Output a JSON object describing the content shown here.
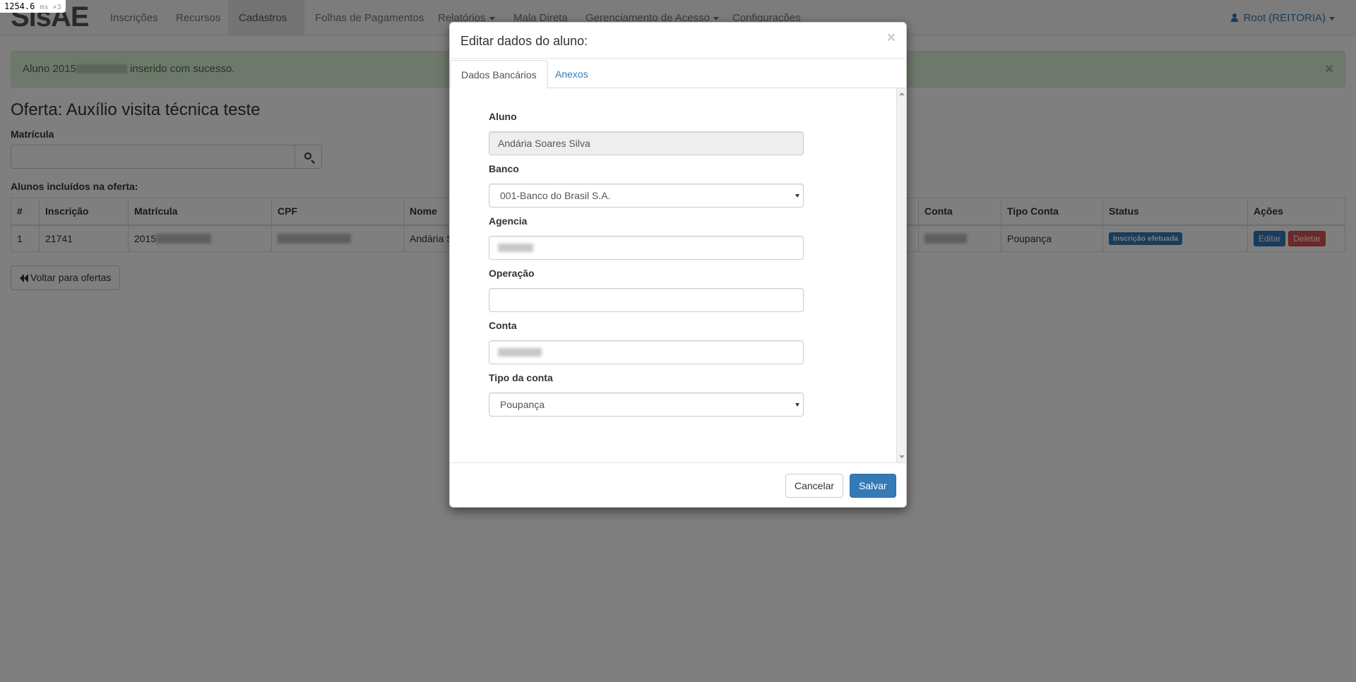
{
  "perf": {
    "value": "1254.6",
    "unit": "ms ×3"
  },
  "navbar": {
    "brand": "SisAE",
    "items": [
      {
        "label": "Inscrições",
        "dropdown": false,
        "active": false
      },
      {
        "label": "Recursos",
        "dropdown": false,
        "active": false
      },
      {
        "label": "Cadastros",
        "dropdown": true,
        "active": true
      },
      {
        "label": "Folhas de Pagamentos",
        "dropdown": false,
        "active": false
      },
      {
        "label": "Relatórios",
        "dropdown": true,
        "active": false
      },
      {
        "label": "Mala Direta",
        "dropdown": false,
        "active": false
      },
      {
        "label": "Gerenciamento de Acesso",
        "dropdown": true,
        "active": false
      },
      {
        "label": "Configurações",
        "dropdown": false,
        "active": false
      }
    ],
    "user": "Root (REITORIA)"
  },
  "alert": {
    "prefix": "Aluno 2015",
    "suffix": "inserido com sucesso.",
    "close": "×"
  },
  "page": {
    "title": "Oferta: Auxílio visita técnica teste",
    "matricula_label": "Matrícula",
    "table_caption": "Alunos incluídos na oferta:",
    "back_button": "Voltar para ofertas"
  },
  "table": {
    "headers": [
      "#",
      "Inscrição",
      "Matrícula",
      "CPF",
      "Nome",
      "Conta",
      "Tipo Conta",
      "Status",
      "Ações"
    ],
    "row": {
      "num": "1",
      "inscricao": "21741",
      "matricula_prefix": "2015",
      "nome": "Andária S",
      "tipo_conta": "Poupança",
      "status": "Inscrição efetuada",
      "edit": "Editar",
      "delete": "Deletar"
    }
  },
  "modal": {
    "title": "Editar dados do aluno:",
    "close": "×",
    "tabs": [
      "Dados Bancários",
      "Anexos"
    ],
    "fields": {
      "aluno_label": "Aluno",
      "aluno_value": "Andária Soares Silva",
      "banco_label": "Banco",
      "banco_value": "001-Banco do Brasil S.A.",
      "agencia_label": "Agencia",
      "operacao_label": "Operação",
      "operacao_value": "",
      "conta_label": "Conta",
      "tipo_label": "Tipo da conta",
      "tipo_value": "Poupança"
    },
    "cancel": "Cancelar",
    "save": "Salvar"
  },
  "colors": {
    "primary": "#337ab7",
    "danger": "#d9534f",
    "success_bg": "#dff0d8",
    "success_text": "#3c763d"
  }
}
